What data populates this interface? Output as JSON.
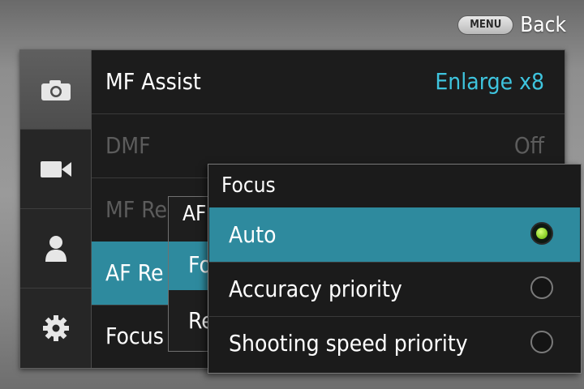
{
  "header": {
    "menu_key": "MENU",
    "back_label": "Back"
  },
  "sidebar": {
    "tabs": [
      {
        "icon": "camera-icon",
        "active": true
      },
      {
        "icon": "video-camera-icon",
        "active": false
      },
      {
        "icon": "person-icon",
        "active": false
      },
      {
        "icon": "gear-icon",
        "active": false
      }
    ]
  },
  "settings": {
    "rows": [
      {
        "label": "MF Assist",
        "value": "Enlarge x8",
        "state": "normal"
      },
      {
        "label": "DMF",
        "value": "Off",
        "state": "disabled"
      },
      {
        "label": "MF Re",
        "value": "",
        "state": "disabled"
      },
      {
        "label": "AF Re",
        "value": "",
        "state": "highlighted"
      },
      {
        "label": "Focus",
        "value": "",
        "state": "normal"
      }
    ]
  },
  "submenu": {
    "title": "AF",
    "items": [
      {
        "label": "Fo",
        "selected": true
      },
      {
        "label": "Re",
        "selected": false
      }
    ]
  },
  "focus_popup": {
    "title": "Focus",
    "options": [
      {
        "label": "Auto",
        "selected": true
      },
      {
        "label": "Accuracy priority",
        "selected": false
      },
      {
        "label": "Shooting speed priority",
        "selected": false
      }
    ]
  },
  "colors": {
    "accent": "#2e8a9e",
    "value_cyan": "#3ec4de",
    "radio_on": "#8ed42a"
  }
}
